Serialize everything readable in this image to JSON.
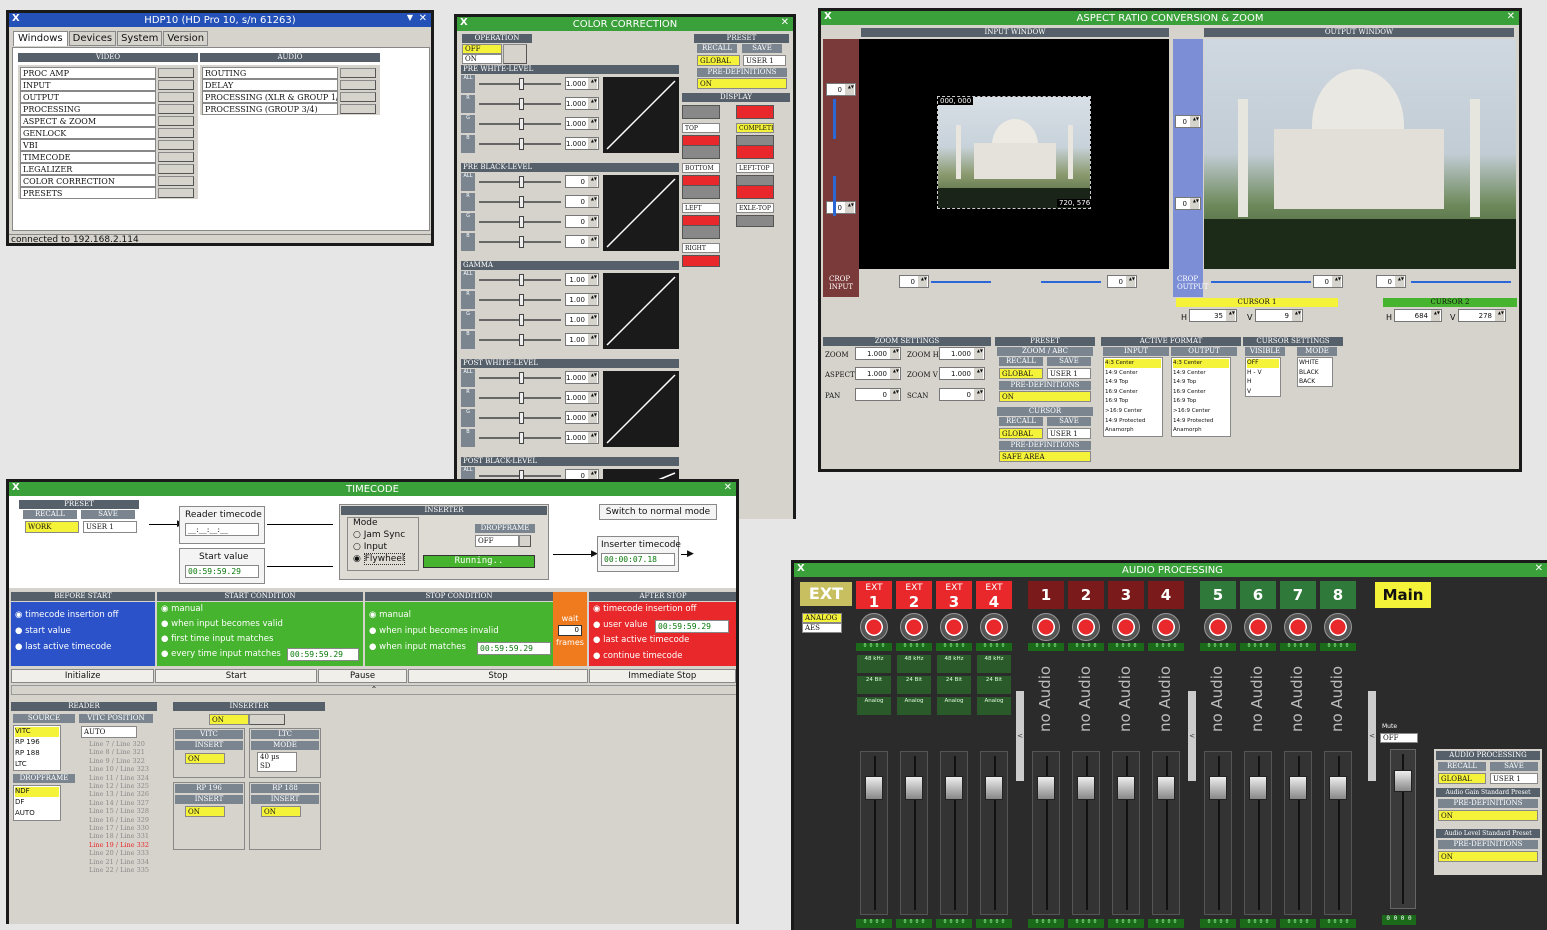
{
  "hdp": {
    "title": "HDP10 (HD Pro 10, s/n 61263)",
    "tabs": [
      "Windows",
      "Devices",
      "System",
      "Version"
    ],
    "video_header": "VIDEO",
    "audio_header": "AUDIO",
    "video_items": [
      "PROC AMP",
      "INPUT",
      "OUTPUT",
      "PROCESSING",
      "ASPECT & ZOOM",
      "GENLOCK",
      "VBI",
      "TIMECODE",
      "LEGALIZER",
      "COLOR CORRECTION",
      "PRESETS"
    ],
    "audio_items": [
      "ROUTING",
      "DELAY",
      "PROCESSING (XLR & GROUP 1/2)",
      "PROCESSING (GROUP 3/4)"
    ],
    "status": "connected to 192.168.2.114"
  },
  "cc": {
    "title": "COLOR CORRECTION",
    "operation": "OPERATION",
    "op_off": "OFF",
    "op_on": "ON",
    "preset": "PRESET",
    "recall": "RECALL",
    "save": "SAVE",
    "global": "GLOBAL",
    "user1": "USER 1",
    "predef": "PRE-DEFINITIONS",
    "predef_val": "ON",
    "display": "DISPLAY",
    "disp_items": [
      "TOP",
      "COMPLETE",
      "BOTTOM",
      "LEFT-TOP",
      "LEFT",
      "EXLE-TOP",
      "RIGHT"
    ],
    "sections": [
      {
        "name": "PRE WHITE-LEVEL",
        "rows": [
          "ALL",
          "R",
          "G",
          "B"
        ],
        "vals": [
          "1.000",
          "1.000",
          "1.000",
          "1.000"
        ]
      },
      {
        "name": "PRE BLACK-LEVEL",
        "rows": [
          "ALL",
          "R",
          "G",
          "B"
        ],
        "vals": [
          "0",
          "0",
          "0",
          "0"
        ]
      },
      {
        "name": "GAMMA",
        "rows": [
          "ALL",
          "R",
          "G",
          "B"
        ],
        "vals": [
          "1.00",
          "1.00",
          "1.00",
          "1.00"
        ]
      },
      {
        "name": "POST WHITE-LEVEL",
        "rows": [
          "ALL",
          "R",
          "G",
          "B"
        ],
        "vals": [
          "1.000",
          "1.000",
          "1.000",
          "1.000"
        ]
      },
      {
        "name": "POST BLACK-LEVEL",
        "rows": [
          "ALL",
          "R"
        ],
        "vals": [
          "0",
          "0"
        ]
      }
    ]
  },
  "ar": {
    "title": "ASPECT RATIO CONVERSION & ZOOM",
    "input_window": "INPUT WINDOW",
    "output_window": "OUTPUT WINDOW",
    "coord1": "000, 000",
    "coord2": "720, 576",
    "crop_input": "CROP INPUT",
    "crop_output": "CROP OUTPUT",
    "zero": "0",
    "cursor1": "CURSOR 1",
    "cursor2": "CURSOR 2",
    "h": "H",
    "v": "V",
    "c1h": "35",
    "c1v": "9",
    "c2h": "684",
    "c2v": "278",
    "zoom_settings": "ZOOM SETTINGS",
    "zoom": "ZOOM",
    "zoom_h": "ZOOM H",
    "aspect": "ASPECT",
    "zoom_v": "ZOOM V",
    "pan": "PAN",
    "scan": "SCAN",
    "one": "1.000",
    "preset": "PRESET",
    "zoom_abc": "ZOOM / ABC",
    "recall": "RECALL",
    "save": "SAVE",
    "global": "GLOBAL",
    "user1": "USER 1",
    "predef": "PRE-DEFINITIONS",
    "on": "ON",
    "cursor": "CURSOR",
    "safe_area": "SAFE AREA",
    "active_format": "ACTIVE FORMAT",
    "input": "INPUT",
    "output": "OUTPUT",
    "formats": [
      "4:3 Center",
      "14:9 Center",
      "14:9 Top",
      "16:9 Center",
      "16:9 Top",
      ">16:9 Center",
      "14:9 Protected",
      "Anamorph"
    ],
    "cursor_settings": "CURSOR SETTINGS",
    "visible": "VISIBLE",
    "mode": "MODE",
    "visible_items": [
      "OFF",
      "H - V",
      "H",
      "V"
    ],
    "mode_items": [
      "WHITE",
      "BLACK",
      "BACK"
    ]
  },
  "tc": {
    "title": "TIMECODE",
    "preset": "PRESET",
    "recall": "RECALL",
    "save": "SAVE",
    "work": "WORK",
    "user1": "USER 1",
    "reader_tc": "Reader timecode",
    "reader_val": "__:__:__:__",
    "start_value": "Start value",
    "start_val": "00:59:59.29",
    "inserter": "INSERTER",
    "mode": "Mode",
    "modes": [
      "Jam Sync",
      "Input",
      "Flywheel"
    ],
    "dropframe": "DROPFRAME",
    "df_off": "OFF",
    "running": "Running..",
    "switch_normal": "Switch to normal mode",
    "inserter_tc": "Inserter timecode",
    "inserter_val": "00:00:07.18",
    "before_start": "BEFORE START",
    "bs_items": [
      "timecode insertion off",
      "start value",
      "last active timecode"
    ],
    "start_cond": "START CONDITION",
    "sc_items": [
      "manual",
      "when input becomes valid",
      "first time input matches",
      "every time input matches"
    ],
    "sc_val": "00:59:59.29",
    "stop_cond": "STOP CONDITION",
    "stc_items": [
      "manual",
      "when input becomes invalid",
      "when input matches"
    ],
    "stc_val": "00:59:59.29",
    "wait": "wait",
    "wait_val": "0",
    "frames": "frames",
    "after_stop": "AFTER STOP",
    "as_items": [
      "timecode insertion off",
      "user value",
      "last active timecode",
      "continue timecode"
    ],
    "as_val": "00:59:59.29",
    "buttons": [
      "Initialize",
      "Start",
      "Pause",
      "Stop",
      "Immediate Stop"
    ],
    "reader": "READER",
    "source": "SOURCE",
    "sources": [
      "VITC",
      "RP 196",
      "RP 188",
      "LTC"
    ],
    "vitc_pos": "VITC POSITION",
    "auto": "AUTO",
    "lines": [
      "Line 7 / Line 320",
      "Line 8 / Line 321",
      "Line 9 / Line 322",
      "Line 10 / Line 323",
      "Line 11 / Line 324",
      "Line 12 / Line 325",
      "Line 13 / Line 326",
      "Line 14 / Line 327",
      "Line 15 / Line 328",
      "Line 16 / Line 329",
      "Line 17 / Line 330",
      "Line 18 / Line 331",
      "Line 19 / Line 332",
      "Line 20 / Line 333",
      "Line 21 / Line 334",
      "Line 22 / Line 335"
    ],
    "dropframe_h": "DROPFRAME",
    "df_items": [
      "NDF",
      "DF",
      "AUTO"
    ],
    "ins2": "INSERTER",
    "on": "ON",
    "vitc": "VITC",
    "ltc": "LTC",
    "insert": "INSERT",
    "mode_h": "MODE",
    "ltc_modes": [
      "40 µs",
      "SD"
    ],
    "rp196": "RP 196",
    "rp188": "RP 188"
  },
  "ap": {
    "title": "AUDIO PROCESSING",
    "ext": "EXT",
    "analog": "ANALOG",
    "aes": "AES",
    "ext_chs": [
      "1",
      "2",
      "3",
      "4"
    ],
    "ext_lbl": "EXT",
    "groups": [
      "1",
      "2",
      "3",
      "4",
      "5",
      "6",
      "7",
      "8"
    ],
    "main": "Main",
    "no_audio": "no Audio",
    "khz": "48 kHz",
    "bit": "24 Bit",
    "analog_l": "Analog",
    "mute": "Mute",
    "mute_val": "OFF",
    "meter": "0 0 0 0",
    "sidepanel": "AUDIO PROCESSING",
    "recall": "RECALL",
    "save": "SAVE",
    "global": "GLOBAL",
    "user1": "USER 1",
    "gain_preset": "Audio Gain Standard Preset",
    "predef": "PRE-DEFINITIONS",
    "on": "ON",
    "level_preset": "Audio Level Standard Preset"
  },
  "colors": {
    "title_blue": "#1a4fb5",
    "title_green": "#3aa03a",
    "title_blue2": "#2b52c8",
    "green": "#46b42e",
    "red": "#e8282a",
    "orange": "#f07a1e",
    "yellow": "#f5f23a"
  }
}
